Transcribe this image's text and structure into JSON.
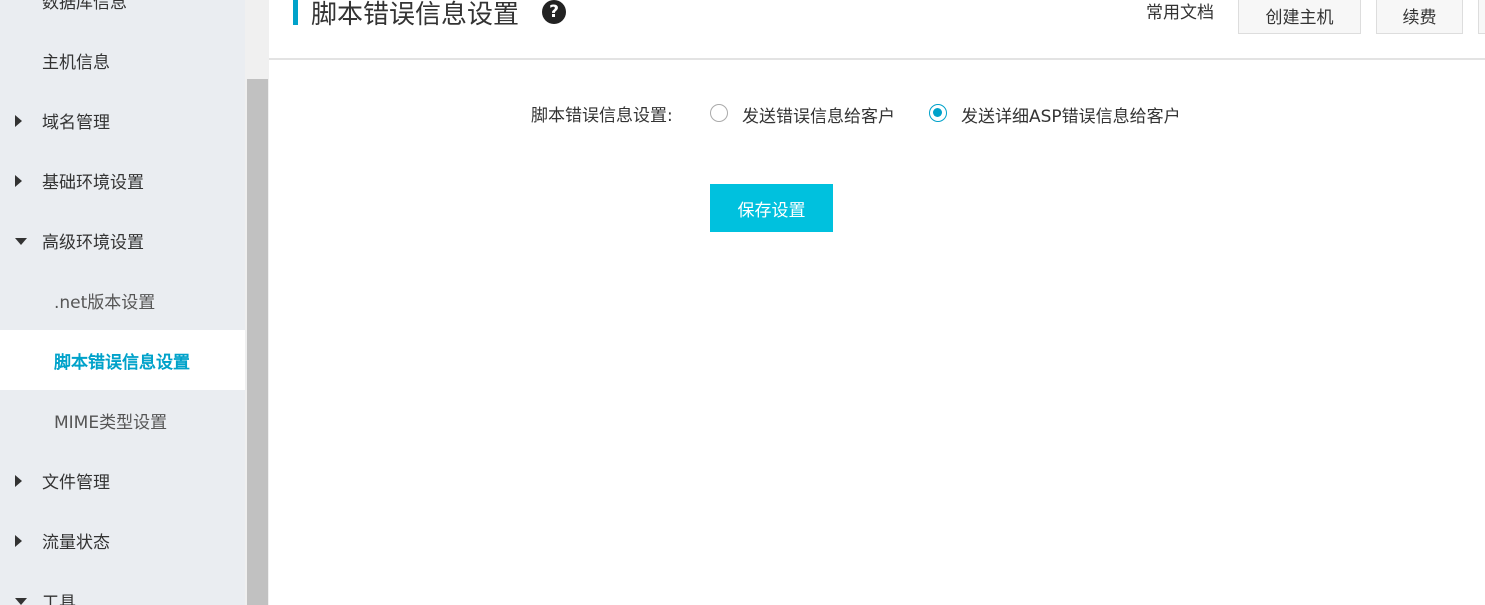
{
  "sidebar": {
    "items": [
      {
        "label": "数据库信息",
        "level": "top",
        "caret": "none"
      },
      {
        "label": "主机信息",
        "level": "top",
        "caret": "none"
      },
      {
        "label": "域名管理",
        "level": "top",
        "caret": "right"
      },
      {
        "label": "基础环境设置",
        "level": "top",
        "caret": "right"
      },
      {
        "label": "高级环境设置",
        "level": "top",
        "caret": "down"
      },
      {
        "label": ".net版本设置",
        "level": "child",
        "caret": "none"
      },
      {
        "label": "脚本错误信息设置",
        "level": "child",
        "caret": "none",
        "active": true
      },
      {
        "label": "MIME类型设置",
        "level": "child",
        "caret": "none"
      },
      {
        "label": "文件管理",
        "level": "top",
        "caret": "right"
      },
      {
        "label": "流量状态",
        "level": "top",
        "caret": "right"
      },
      {
        "label": "工具",
        "level": "top",
        "caret": "down"
      }
    ]
  },
  "header": {
    "title": "脚本错误信息设置",
    "help_icon": "?",
    "doc_link": "常用文档",
    "create_button": "创建主机",
    "renew_button": "续费"
  },
  "form": {
    "label": "脚本错误信息设置:",
    "options": [
      {
        "label": "发送错误信息给客户",
        "checked": false
      },
      {
        "label": "发送详细ASP错误信息给客户",
        "checked": true
      }
    ],
    "save_button": "保存设置"
  },
  "colors": {
    "accent": "#00a2ca",
    "button": "#00c1de",
    "sidebar_bg": "#eaedf1"
  }
}
